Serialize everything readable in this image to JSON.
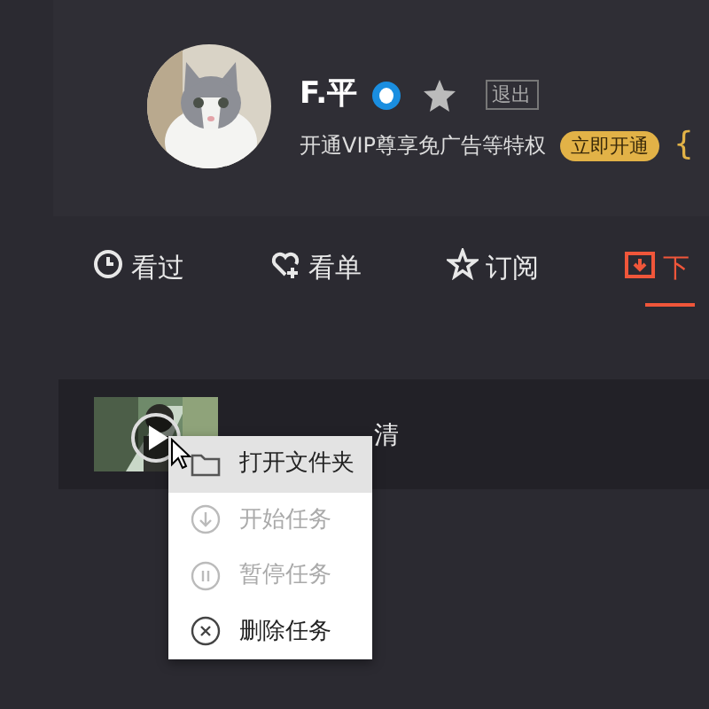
{
  "profile": {
    "name": "F.平",
    "logout": "退出",
    "vip_text": "开通VIP尊享免广告等特权",
    "vip_button": "立即开通",
    "bracket": "{"
  },
  "tabs": [
    {
      "label": "看过",
      "selected": false
    },
    {
      "label": "看单",
      "selected": false
    },
    {
      "label": "订阅",
      "selected": false
    },
    {
      "label": "下",
      "selected": true
    }
  ],
  "download": {
    "title": "清"
  },
  "context_menu": [
    {
      "label": "打开文件夹",
      "disabled": false,
      "selected": true
    },
    {
      "label": "开始任务",
      "disabled": true,
      "selected": false
    },
    {
      "label": "暂停任务",
      "disabled": true,
      "selected": false
    },
    {
      "label": "删除任务",
      "disabled": false,
      "selected": false
    }
  ]
}
